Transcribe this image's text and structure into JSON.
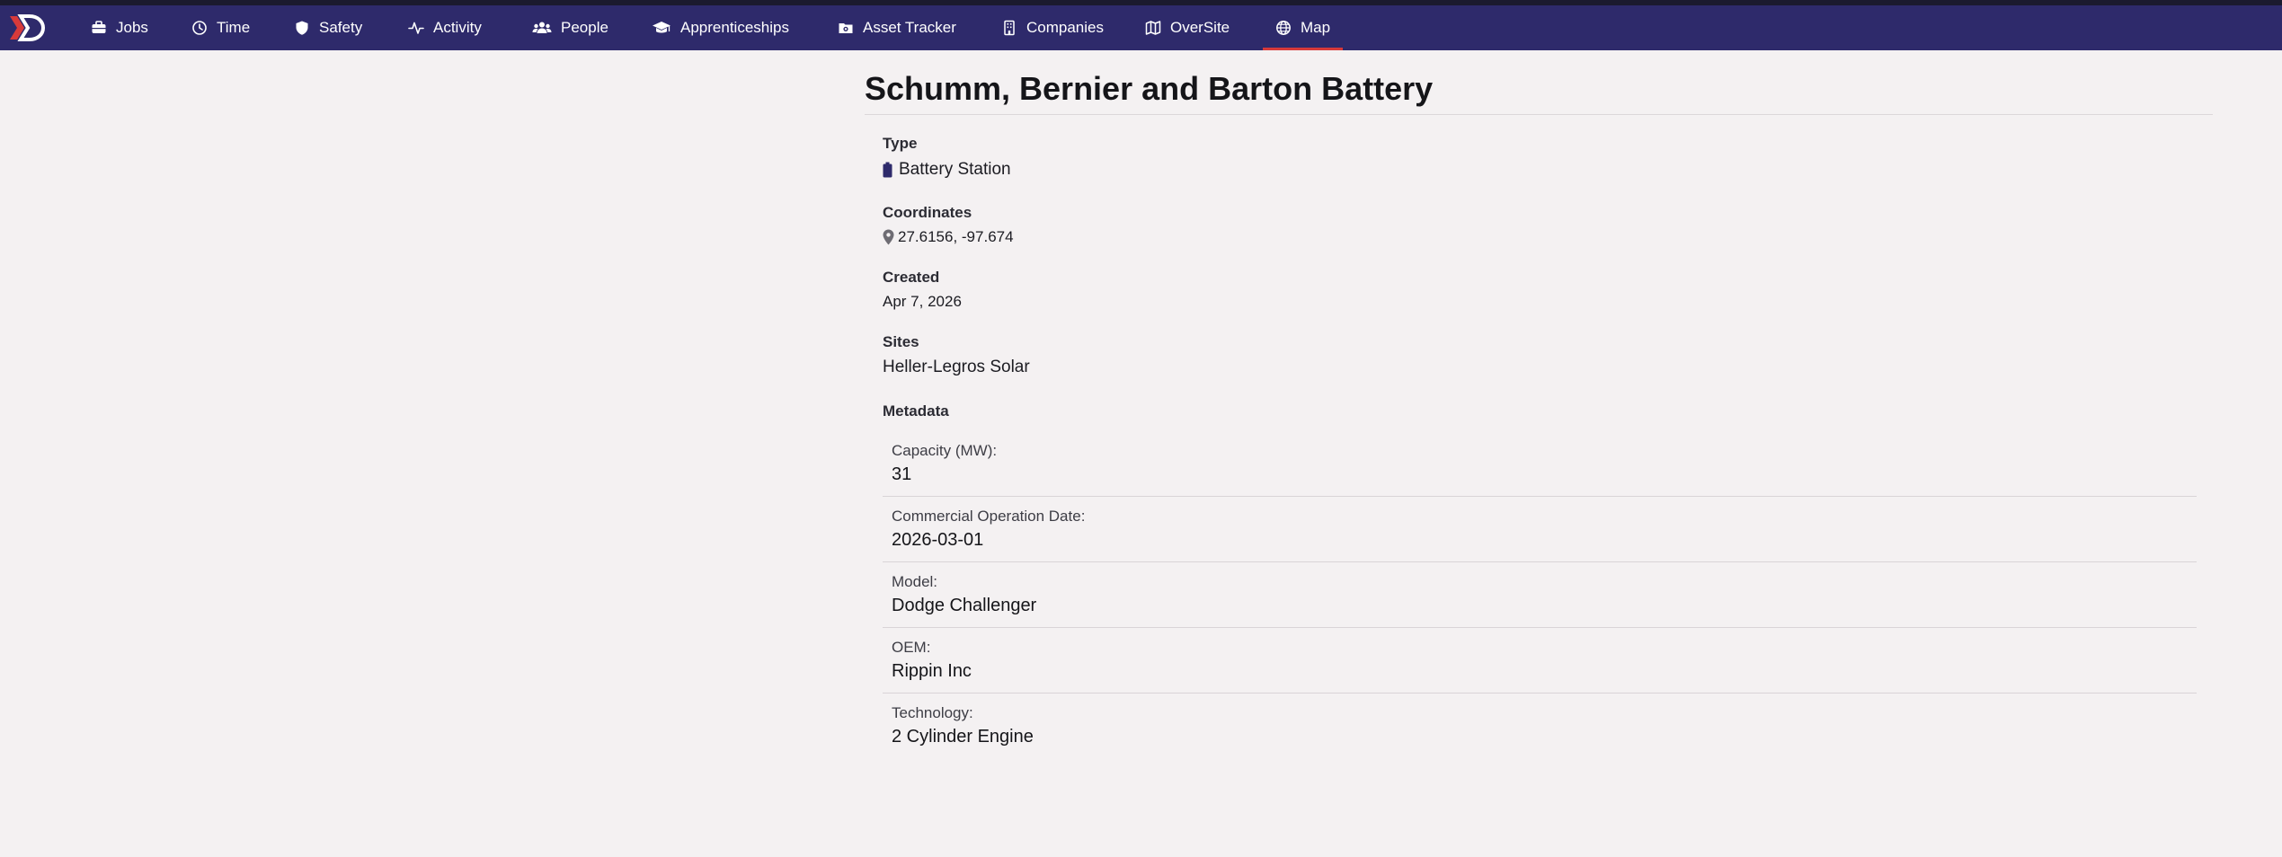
{
  "nav": {
    "items": [
      {
        "label": "Jobs",
        "icon": "briefcase-icon"
      },
      {
        "label": "Time",
        "icon": "clock-icon"
      },
      {
        "label": "Safety",
        "icon": "shield-icon"
      },
      {
        "label": "Activity",
        "icon": "pulse-icon"
      },
      {
        "label": "People",
        "icon": "users-icon"
      },
      {
        "label": "Apprenticeships",
        "icon": "graduation-cap-icon"
      },
      {
        "label": "Asset Tracker",
        "icon": "camera-folder-icon"
      },
      {
        "label": "Companies",
        "icon": "building-icon"
      },
      {
        "label": "OverSite",
        "icon": "map-fold-icon"
      },
      {
        "label": "Map",
        "icon": "globe-icon"
      }
    ],
    "active": "Map",
    "accent_color": "#d83a3a",
    "bar_color": "#2e2a6b"
  },
  "asset": {
    "title": "Schumm, Bernier and Barton Battery",
    "type_label": "Type",
    "type_value": "Battery Station",
    "type_icon": "battery-icon",
    "coordinates_label": "Coordinates",
    "coordinates_value": "27.6156, -97.674",
    "coordinates_icon": "map-pin-icon",
    "created_label": "Created",
    "created_value": "Apr 7, 2026",
    "sites_label": "Sites",
    "sites_value": "Heller-Legros Solar",
    "metadata_label": "Metadata",
    "metadata": [
      {
        "key": "Capacity (MW):",
        "value": "31"
      },
      {
        "key": "Commercial Operation Date:",
        "value": "2026-03-01"
      },
      {
        "key": "Model:",
        "value": "Dodge Challenger"
      },
      {
        "key": "OEM:",
        "value": "Rippin Inc"
      },
      {
        "key": "Technology:",
        "value": "2 Cylinder Engine"
      }
    ]
  }
}
